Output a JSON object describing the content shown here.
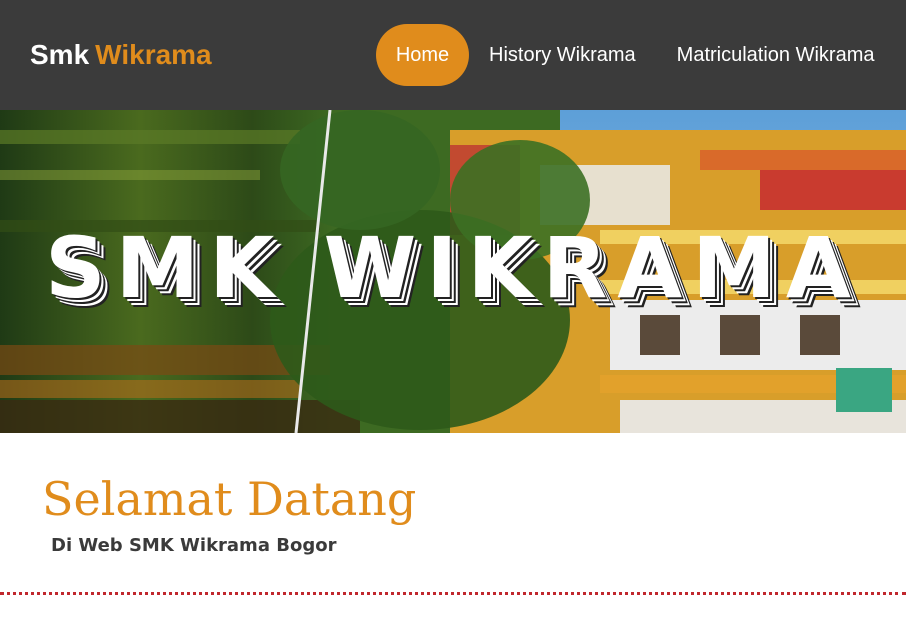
{
  "navbar": {
    "brand_part1": "Smk",
    "brand_part2": "Wikrama",
    "items": [
      {
        "label": "Home",
        "active": true
      },
      {
        "label": "History Wikrama",
        "active": false
      },
      {
        "label": "Matriculation Wikrama",
        "active": false
      }
    ]
  },
  "hero": {
    "title": "SMK WIKRAMA"
  },
  "main": {
    "heading": "Selamat Datang",
    "subheading": "Di Web SMK Wikrama Bogor"
  },
  "colors": {
    "navbar_bg": "#3b3b3b",
    "accent": "#e08c1c",
    "divider": "#c0272d"
  }
}
